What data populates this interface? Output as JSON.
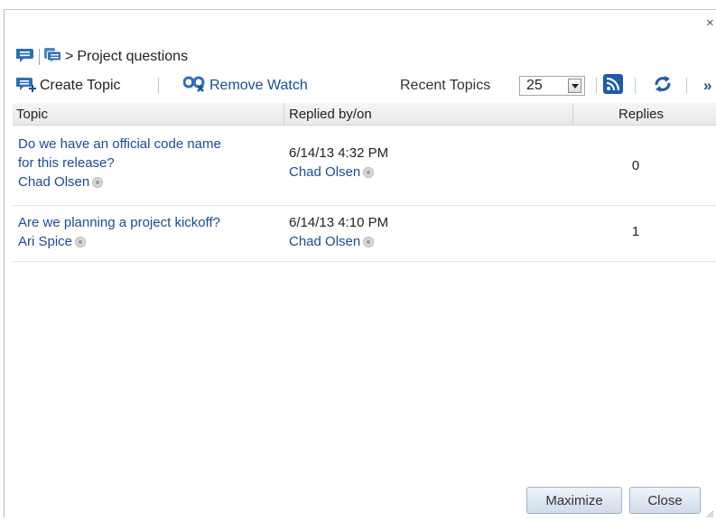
{
  "window": {
    "close_glyph": "×"
  },
  "breadcrumb": {
    "separator": ">",
    "current": "Project questions"
  },
  "toolbar": {
    "create_topic": "Create Topic",
    "remove_watch": "Remove Watch",
    "recent_topics_label": "Recent Topics",
    "recent_topics_count": "25",
    "overflow_glyph": "»"
  },
  "table": {
    "headers": [
      "Topic",
      "Replied by/on",
      "Replies"
    ],
    "rows": [
      {
        "topic_line1": "Do we have an official code name",
        "topic_line2": "for this release?",
        "author": "Chad Olsen",
        "replied_on": "6/14/13 4:32 PM",
        "replied_by": "Chad Olsen",
        "replies": "0"
      },
      {
        "topic_line1": "Are we planning a project kickoff?",
        "author": "Ari Spice",
        "replied_on": "6/14/13 4:10 PM",
        "replied_by": "Chad Olsen",
        "replies": "1"
      }
    ]
  },
  "footer": {
    "maximize": "Maximize",
    "close": "Close"
  },
  "colors": {
    "link": "#1a4b9c",
    "icon_blue": "#2f6fb6",
    "button_border": "#9fb4c8"
  },
  "icons": [
    "discussion-icon",
    "forum-icon",
    "create-topic-icon",
    "remove-watch-icon",
    "dropdown-arrow-icon",
    "rss-feed-icon",
    "refresh-icon",
    "presence-icon",
    "resize-grip-icon"
  ]
}
